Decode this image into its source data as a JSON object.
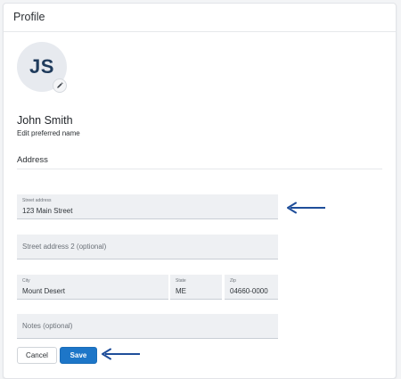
{
  "header": {
    "title": "Profile"
  },
  "profile": {
    "initials": "JS",
    "name": "John Smith",
    "edit_preferred_name": "Edit preferred name"
  },
  "address": {
    "section_label": "Address",
    "street": {
      "label": "Street address",
      "value": "123 Main Street"
    },
    "street2": {
      "placeholder": "Street address 2 (optional)"
    },
    "city": {
      "label": "City",
      "value": "Mount Desert"
    },
    "state": {
      "label": "State",
      "value": "ME"
    },
    "zip": {
      "label": "Zip",
      "value": "04660-0000"
    },
    "notes": {
      "placeholder": "Notes (optional)"
    }
  },
  "actions": {
    "cancel_label": "Cancel",
    "save_label": "Save"
  },
  "colors": {
    "accent": "#1d76c8",
    "arrow": "#1f4e9a",
    "avatar_text": "#1f3b5c"
  },
  "annotations": [
    {
      "icon": "arrow-left-icon",
      "points_to": "street-address-field"
    },
    {
      "icon": "arrow-left-icon",
      "points_to": "save-button"
    }
  ]
}
